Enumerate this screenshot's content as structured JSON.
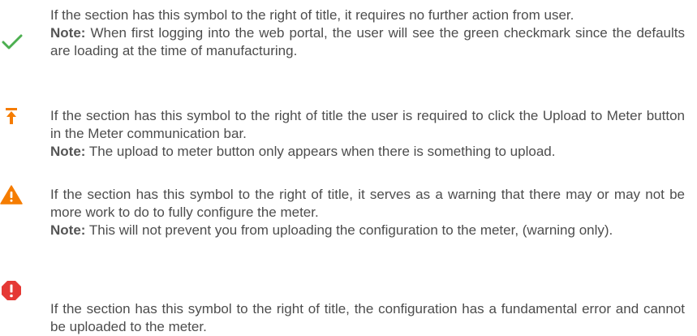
{
  "entries": [
    {
      "icon": "green-checkmark-icon",
      "icon_color": "#4caf50",
      "description": "If the section has this symbol to the right of title, it requires no further action from user.",
      "note_label": "Note:",
      "note_text": " When first logging into the web portal, the user will see the green checkmark since the defaults are loading at the time of manufacturing."
    },
    {
      "icon": "upload-arrow-icon",
      "icon_color": "#f57c00",
      "description": "If the section has this symbol to the right of title the user is required to click the Upload to Meter button in the Meter communication bar.",
      "note_label": "Note:",
      "note_text": " The upload to meter button only appears when there is something to upload."
    },
    {
      "icon": "warning-triangle-icon",
      "icon_color": "#f57c00",
      "description": "If the section has this symbol to the right of title, it serves as a warning that there may or may not be more work to do to fully configure the meter.",
      "note_label": "Note:",
      "note_text": " This will not prevent you from uploading the configuration to the meter, (warning only)."
    },
    {
      "icon": "error-octagon-icon",
      "icon_color": "#e53935",
      "description": "If the section has this symbol to the right of title, the configuration has a fundamental error and cannot be uploaded to the meter."
    }
  ]
}
